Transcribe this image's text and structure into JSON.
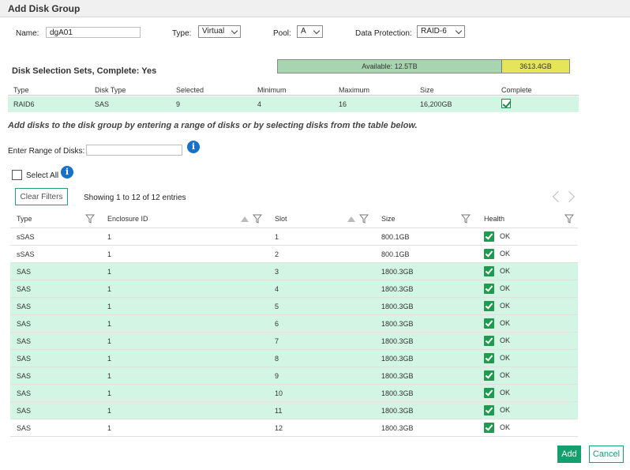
{
  "dialog": {
    "title": "Add Disk Group"
  },
  "form": {
    "name_label": "Name:",
    "name_value": "dgA01",
    "type_label": "Type:",
    "type_value": "Virtual",
    "pool_label": "Pool:",
    "pool_value": "A",
    "protection_label": "Data Protection:",
    "protection_value": "RAID-6"
  },
  "capacity": {
    "available_label": "Available: 12.5TB",
    "used_label": "3613.4GB",
    "used_fraction": 0.23
  },
  "selection_sets": {
    "title": "Disk Selection Sets, Complete: Yes",
    "headers": [
      "Type",
      "Disk Type",
      "Selected",
      "Minimum",
      "Maximum",
      "Size",
      "Complete"
    ],
    "row": {
      "type": "RAID6",
      "disk_type": "SAS",
      "selected": "9",
      "minimum": "4",
      "maximum": "16",
      "size": "16,200GB",
      "complete": true
    }
  },
  "instructions": "Add disks to the disk group by entering a range of disks or by selecting disks from the table below.",
  "range": {
    "label": "Enter Range of Disks:",
    "value": ""
  },
  "select_all_label": "Select All",
  "table_controls": {
    "clear_filters": "Clear Filters",
    "showing": "Showing 1 to 12 of 12 entries"
  },
  "disk_table": {
    "headers": [
      "Type",
      "Enclosure ID",
      "Slot",
      "Size",
      "Health"
    ],
    "rows": [
      {
        "type": "sSAS",
        "enclosure": "1",
        "slot": "1",
        "size": "800.1GB",
        "health": "OK",
        "selected": false
      },
      {
        "type": "sSAS",
        "enclosure": "1",
        "slot": "2",
        "size": "800.1GB",
        "health": "OK",
        "selected": false
      },
      {
        "type": "SAS",
        "enclosure": "1",
        "slot": "3",
        "size": "1800.3GB",
        "health": "OK",
        "selected": true
      },
      {
        "type": "SAS",
        "enclosure": "1",
        "slot": "4",
        "size": "1800.3GB",
        "health": "OK",
        "selected": true
      },
      {
        "type": "SAS",
        "enclosure": "1",
        "slot": "5",
        "size": "1800.3GB",
        "health": "OK",
        "selected": true
      },
      {
        "type": "SAS",
        "enclosure": "1",
        "slot": "6",
        "size": "1800.3GB",
        "health": "OK",
        "selected": true
      },
      {
        "type": "SAS",
        "enclosure": "1",
        "slot": "7",
        "size": "1800.3GB",
        "health": "OK",
        "selected": true
      },
      {
        "type": "SAS",
        "enclosure": "1",
        "slot": "8",
        "size": "1800.3GB",
        "health": "OK",
        "selected": true
      },
      {
        "type": "SAS",
        "enclosure": "1",
        "slot": "9",
        "size": "1800.3GB",
        "health": "OK",
        "selected": true
      },
      {
        "type": "SAS",
        "enclosure": "1",
        "slot": "10",
        "size": "1800.3GB",
        "health": "OK",
        "selected": true
      },
      {
        "type": "SAS",
        "enclosure": "1",
        "slot": "11",
        "size": "1800.3GB",
        "health": "OK",
        "selected": true
      },
      {
        "type": "SAS",
        "enclosure": "1",
        "slot": "12",
        "size": "1800.3GB",
        "health": "OK",
        "selected": false
      }
    ]
  },
  "buttons": {
    "add": "Add",
    "cancel": "Cancel"
  },
  "colors": {
    "accent": "#14a06e",
    "selected_row": "#d3f5e3",
    "available": "#a8d4b0",
    "used": "#e6e45a",
    "info": "#1a6fc7"
  },
  "icons": {
    "info": "info-icon",
    "filter": "filter-icon",
    "sort": "sort-icon",
    "health": "check-icon"
  }
}
